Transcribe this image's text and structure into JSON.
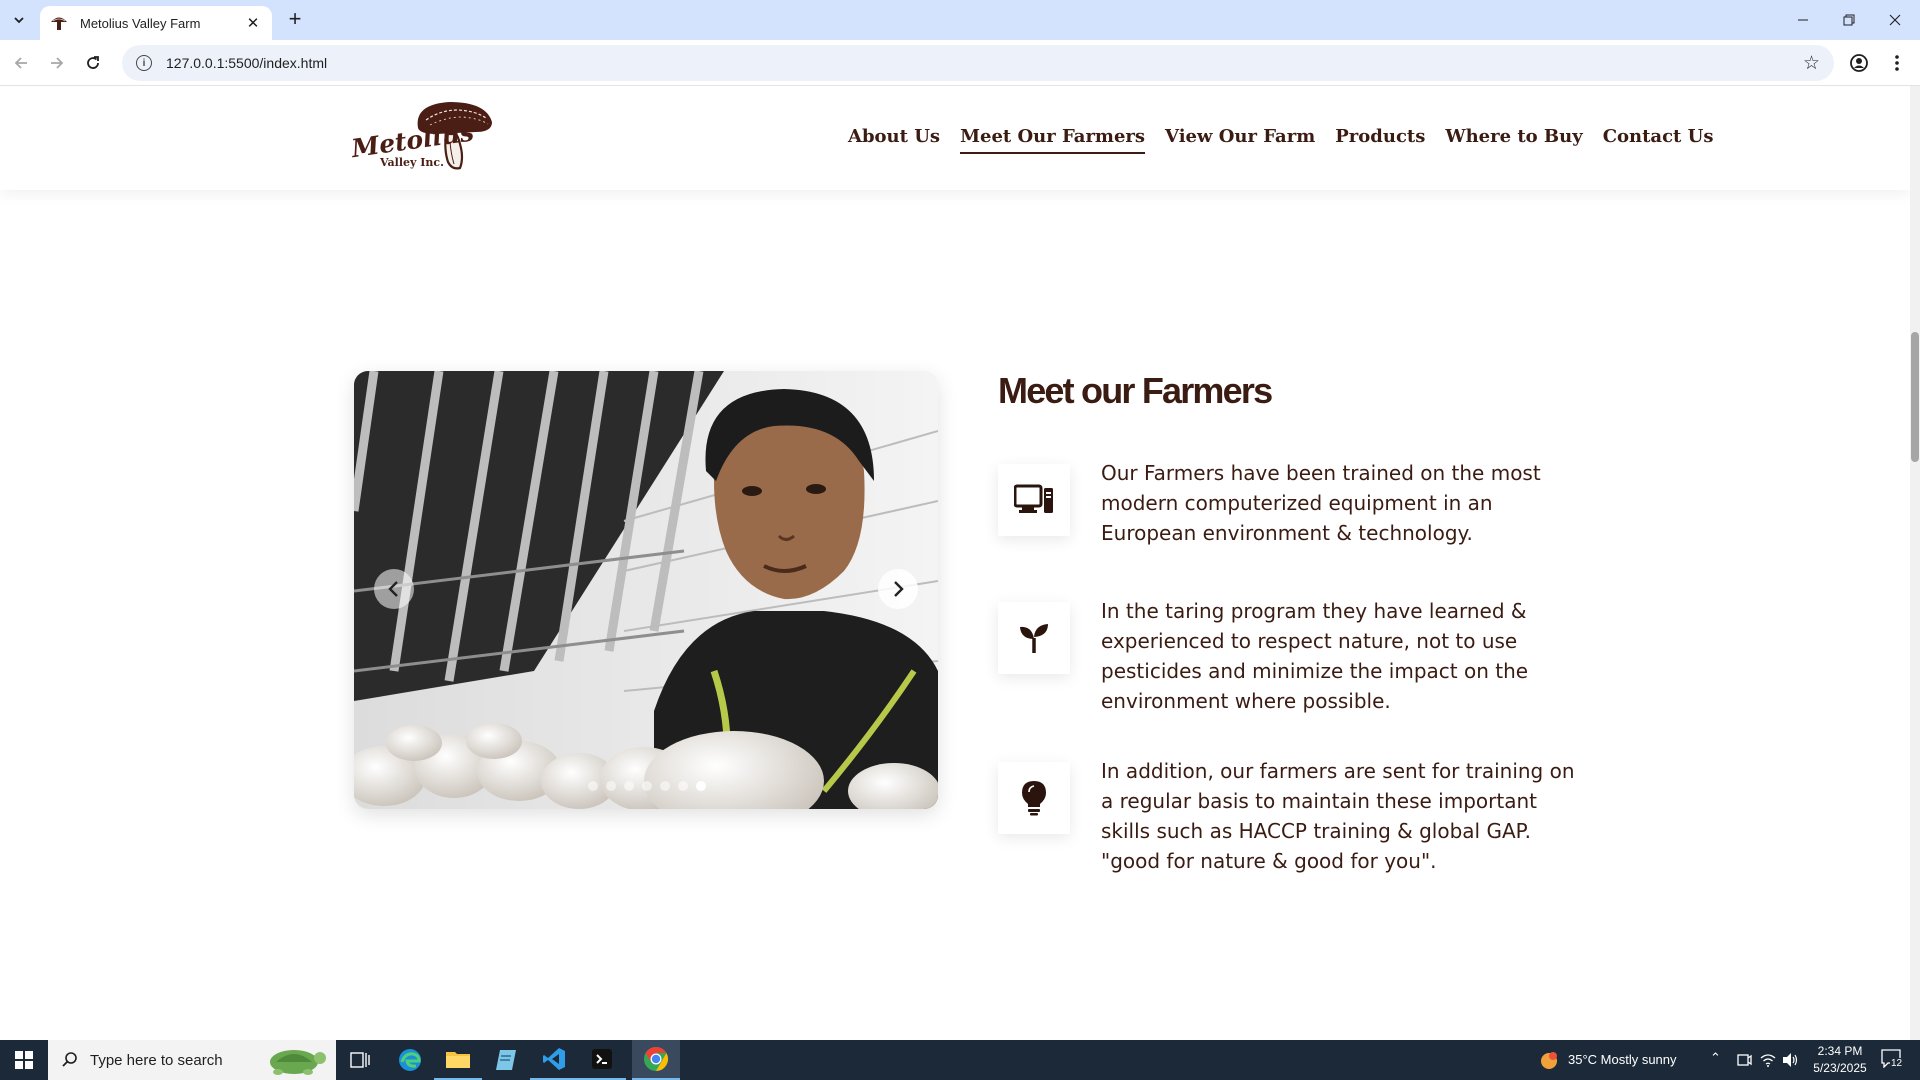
{
  "browser": {
    "tab_title": "Metolius Valley Farm",
    "new_tab_symbol": "+",
    "close_tab_symbol": "✕",
    "url": "127.0.0.1:5500/index.html"
  },
  "site": {
    "logo_alt": "Metolius Valley Inc.",
    "logo_line1": "Metolius",
    "logo_line2": "Valley Inc.",
    "nav": [
      {
        "label": "About Us",
        "active": false
      },
      {
        "label": "Meet Our Farmers",
        "active": true
      },
      {
        "label": "View Our Farm",
        "active": false
      },
      {
        "label": "Products",
        "active": false
      },
      {
        "label": "Where to Buy",
        "active": false
      },
      {
        "label": "Contact Us",
        "active": false
      }
    ],
    "brand_color": "#3b1c12"
  },
  "carousel": {
    "slide_count": 7,
    "active_index": 6,
    "prev_icon": "chevron-left-icon",
    "next_icon": "chevron-right-icon"
  },
  "section": {
    "title": "Meet our Farmers",
    "features": [
      {
        "icon": "computer-icon",
        "text": "Our Farmers have been trained on the most modern computerized equipment in an European environment & technology."
      },
      {
        "icon": "seedling-icon",
        "text": "In the taring program they have learned & experienced to respect nature, not to use pesticides and minimize the impact on the environment where possible."
      },
      {
        "icon": "lightbulb-icon",
        "text": "In addition, our farmers are sent for training on a regular basis to maintain these important skills such as HACCP training & global GAP. \"good for nature & good for you\"."
      }
    ]
  },
  "taskbar": {
    "search_placeholder": "Type here to search",
    "weather": "35°C  Mostly sunny",
    "time": "2:34 PM",
    "date": "5/23/2025",
    "notification_count": "12"
  }
}
